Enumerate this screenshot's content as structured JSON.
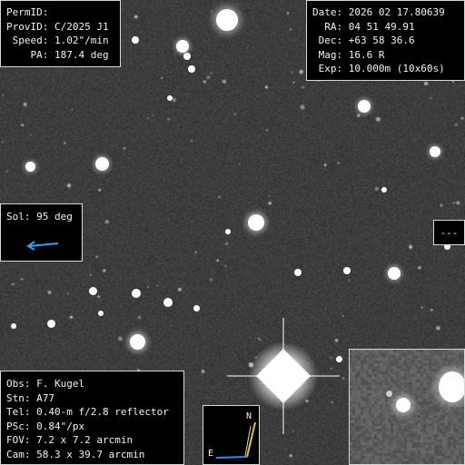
{
  "object_info": {
    "lines": [
      "PermID:",
      "ProvID: C/2025 J1",
      " Speed: 1.02\"/min",
      "    PA: 187.4 deg"
    ]
  },
  "observation": {
    "lines": [
      "Date: 2026 02 17.80639",
      "  RA: 04 51 49.91",
      " Dec: +63 58 36.6",
      " Mag: 16.6 R",
      " Exp: 10.000m (10x60s)"
    ]
  },
  "sun_direction": {
    "label": "Sol: 95 deg",
    "arrow_color": "#29a3ff",
    "icon": "sun-direction-arrow-icon"
  },
  "side_marker": {
    "text": "---"
  },
  "equipment": {
    "lines": [
      "Obs: F. Kugel",
      "Stn: A77",
      "Tel: 0.40-m f/2.8 reflector",
      "PSc: 0.84\"/px",
      "FOV: 7.2 x 7.2 arcmin",
      "Cam: 58.3 x 39.7 arcmin"
    ]
  },
  "compass": {
    "north_label": "N",
    "east_label": "E",
    "north_color": "#e6c229",
    "east_color": "#2b8fe6",
    "icon": "compass-icon"
  },
  "inset": {
    "icon": "comet-zoom-inset"
  },
  "colors": {
    "panel_bg": "#000000",
    "panel_border": "#d8d8d8",
    "text": "#f2f2f2",
    "sky": "#3a3a3a"
  }
}
